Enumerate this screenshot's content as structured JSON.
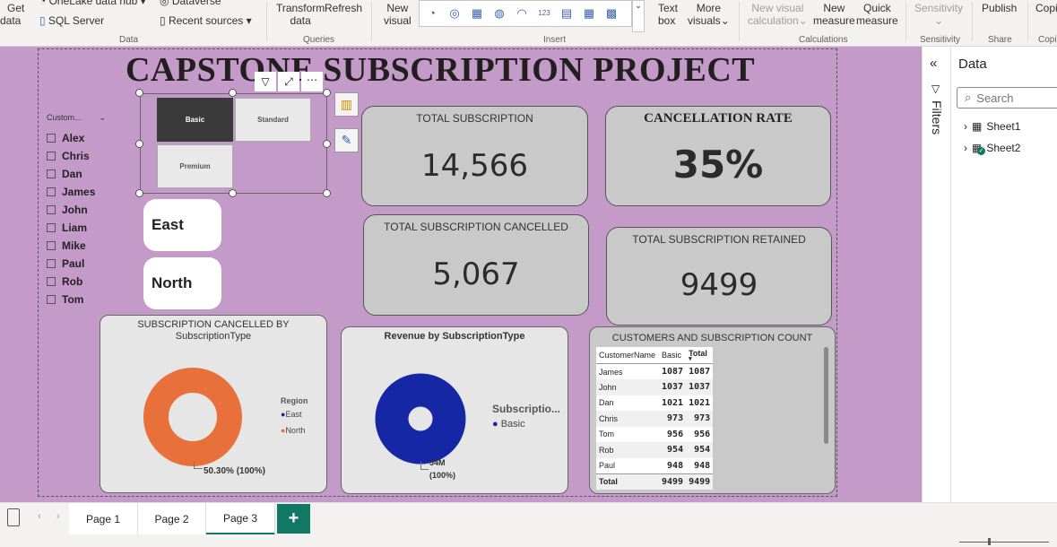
{
  "ribbon": {
    "get_data": "Get",
    "get_data2": "data",
    "onelake": "OneLake data hub",
    "dataverse": "Dataverse",
    "sql_server": "SQL Server",
    "recent_sources": "Recent sources",
    "group_data": "Data",
    "transform": "Transform",
    "transform2": "data",
    "refresh": "Refresh",
    "group_queries": "Queries",
    "new_visual": "New",
    "new_visual2": "visual",
    "text_box": "Text",
    "text_box2": "box",
    "more_visuals": "More",
    "more_visuals2": "visuals",
    "group_insert": "Insert",
    "new_visual_calc": "New visual",
    "new_visual_calc2": "calculation",
    "new_measure": "New",
    "new_measure2": "measure",
    "quick_measure": "Quick",
    "quick_measure2": "measure",
    "group_calculations": "Calculations",
    "sensitivity": "Sensitivity",
    "group_sensitivity": "Sensitivity",
    "publish": "Publish",
    "group_share": "Share",
    "copilot": "Copi",
    "group_copilot": "Copi"
  },
  "report": {
    "title": "CAPSTONE SUBSCRIPTION PROJECT",
    "customer_slicer": {
      "header": "Custom...",
      "items": [
        "Alex",
        "Chris",
        "Dan",
        "James",
        "John",
        "Liam",
        "Mike",
        "Paul",
        "Rob",
        "Tom"
      ]
    },
    "subscription_tiles": [
      "Basic",
      "Standard",
      "Premium"
    ],
    "region_pills": [
      "East",
      "North"
    ],
    "cards": {
      "total_subscription": {
        "label": "TOTAL SUBSCRIPTION",
        "value": "14,566"
      },
      "cancellation_rate": {
        "label": "CANCELLATION RATE",
        "value": "35%"
      },
      "total_cancelled": {
        "label": "TOTAL SUBSCRIPTION CANCELLED",
        "value": "5,067"
      },
      "total_retained": {
        "label": "TOTAL SUBSCRIPTION RETAINED",
        "value": "9499"
      }
    },
    "donut_cancelled": {
      "title_line1": "SUBSCRIPTION CANCELLED BY",
      "title_line2": "SubscriptionType",
      "legend_title": "Region",
      "legend": [
        {
          "name": "East",
          "color": "#1b2a8f"
        },
        {
          "name": "North",
          "color": "#e8703a"
        }
      ],
      "data_label": "50.30% (100%)",
      "ring_color": "#e8703a"
    },
    "donut_revenue": {
      "title": "Revenue by SubscriptionType",
      "legend_title": "Subscriptio...",
      "legend": [
        {
          "name": "Basic",
          "color": "#1627a6"
        }
      ],
      "data_label_1": "34M",
      "data_label_2": "(100%)",
      "ring_color": "#1627a6"
    },
    "matrix": {
      "title": "CUSTOMERS AND SUBSCRIPTION COUNT",
      "headers": [
        "CustomerName",
        "Basic",
        "Total"
      ],
      "rows": [
        [
          "James",
          "1087",
          "1087"
        ],
        [
          "John",
          "1037",
          "1037"
        ],
        [
          "Dan",
          "1021",
          "1021"
        ],
        [
          "Chris",
          "973",
          "973"
        ],
        [
          "Tom",
          "956",
          "956"
        ],
        [
          "Rob",
          "954",
          "954"
        ],
        [
          "Paul",
          "948",
          "948"
        ],
        [
          "Total",
          "9499",
          "9499"
        ]
      ]
    }
  },
  "filters_pane": {
    "label": "Filters"
  },
  "data_pane": {
    "title": "Data",
    "search_placeholder": "Search",
    "tables": [
      "Sheet1",
      "Sheet2"
    ]
  },
  "pages": {
    "tabs": [
      "Page 1",
      "Page 2",
      "Page 3"
    ],
    "active": "Page 3",
    "add_label": "+"
  },
  "colors": {
    "canvas": "#c49ac9",
    "accent_green": "#117865"
  }
}
